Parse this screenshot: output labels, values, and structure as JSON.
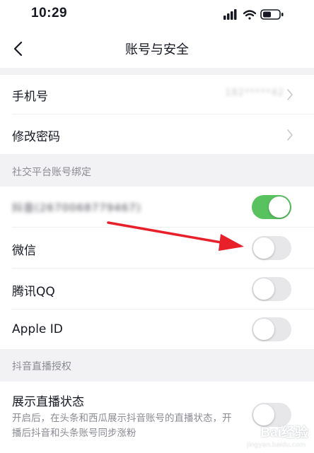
{
  "status_bar": {
    "time": "10:29"
  },
  "nav": {
    "title": "账号与安全"
  },
  "account_rows": [
    {
      "label": "手机号",
      "value": "182*****42"
    },
    {
      "label": "修改密码"
    }
  ],
  "social_section": {
    "title": "社交平台账号绑定",
    "items": [
      {
        "label": "抖音(2670068779467)",
        "enabled": true
      },
      {
        "label": "微信",
        "enabled": false
      },
      {
        "label": "腾讯QQ",
        "enabled": false
      },
      {
        "label": "Apple ID",
        "enabled": false
      }
    ]
  },
  "live_section": {
    "title": "抖音直播授权",
    "item": {
      "label": "展示直播状态",
      "description": "开启后，在头条和西瓜展示抖音账号的直播状态，开播后抖音和头条账号同步涨粉",
      "enabled": false
    }
  },
  "colors": {
    "toggle_on": "#58c25f",
    "toggle_off": "#e7e7ea",
    "annotation": "#e8202a"
  },
  "watermark": {
    "text": "Bai经验",
    "url": "jingyan.baidu.com"
  }
}
